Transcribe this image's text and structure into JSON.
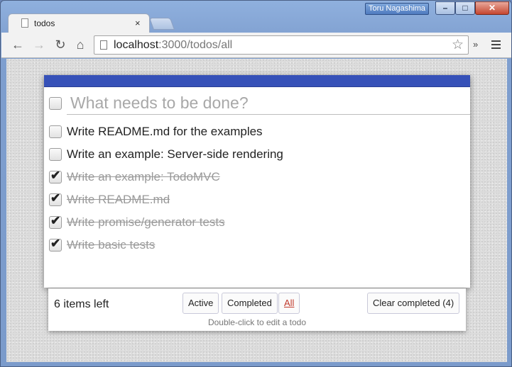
{
  "window": {
    "user_badge": "Toru Nagashima",
    "minimize": "–",
    "maximize": "□",
    "close": "✕"
  },
  "tab": {
    "title": "todos",
    "close": "×"
  },
  "toolbar": {
    "url_host": "localhost",
    "url_rest": ":3000/todos/all",
    "back": "←",
    "forward": "→",
    "reload": "↻",
    "home": "⌂",
    "star": "☆",
    "more": "»"
  },
  "app": {
    "new_todo_placeholder": "What needs to be done?",
    "todos": [
      {
        "label": "Write README.md for the examples",
        "completed": false
      },
      {
        "label": "Write an example: Server-side rendering",
        "completed": false
      },
      {
        "label": "Write an example: TodoMVC",
        "completed": true
      },
      {
        "label": "Write README.md",
        "completed": true
      },
      {
        "label": "Write promise/generator tests",
        "completed": true
      },
      {
        "label": "Write basic tests",
        "completed": true
      }
    ],
    "checkmark": "✔"
  },
  "footer": {
    "items_left": "6 items left",
    "filter_active": "Active",
    "filter_completed": "Completed",
    "filter_all": "All",
    "clear_completed": "Clear completed (4)",
    "hint": "Double-click to edit a todo"
  }
}
